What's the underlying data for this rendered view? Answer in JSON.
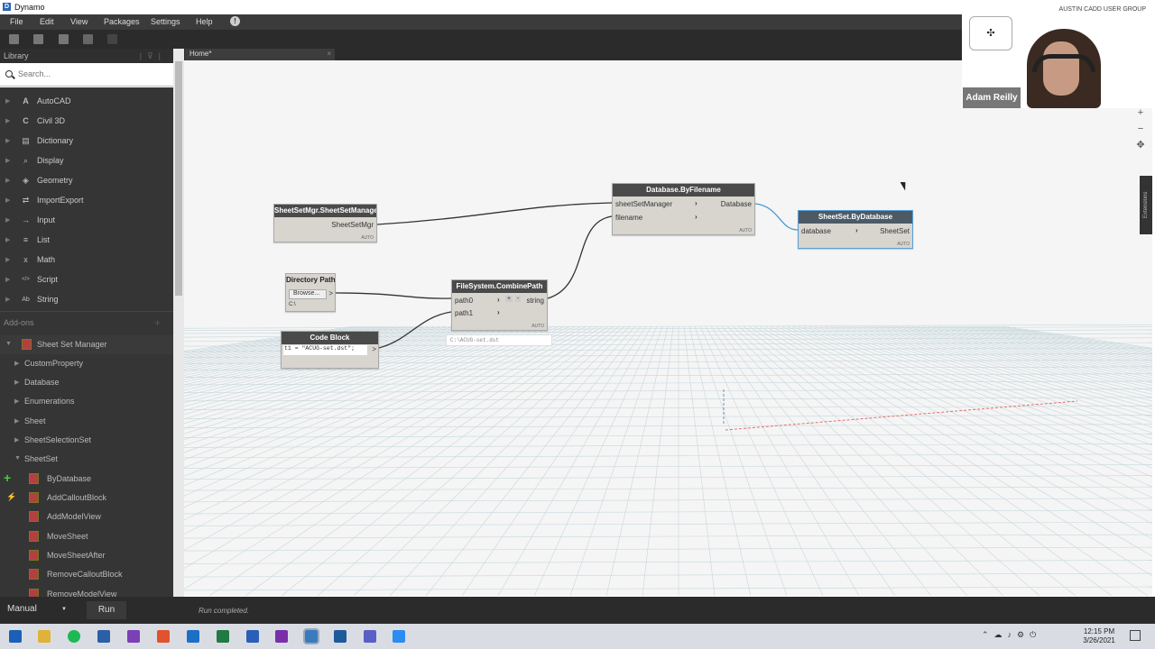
{
  "app": {
    "title": "Dynamo"
  },
  "menu": [
    "File",
    "Edit",
    "View",
    "Packages",
    "Settings",
    "Help"
  ],
  "library": {
    "title": "Library",
    "search_placeholder": "Search...",
    "categories": [
      {
        "label": "AutoCAD",
        "icon": "A"
      },
      {
        "label": "Civil 3D",
        "icon": "C"
      },
      {
        "label": "Dictionary",
        "icon": "▤"
      },
      {
        "label": "Display",
        "icon": "⌕"
      },
      {
        "label": "Geometry",
        "icon": "◈"
      },
      {
        "label": "ImportExport",
        "icon": "⇄"
      },
      {
        "label": "Input",
        "icon": "→"
      },
      {
        "label": "List",
        "icon": "≡"
      },
      {
        "label": "Math",
        "icon": "x"
      },
      {
        "label": "Script",
        "icon": "</>"
      },
      {
        "label": "String",
        "icon": "Ab"
      }
    ],
    "addons_label": "Add-ons",
    "package": "Sheet Set Manager",
    "subcats": [
      "CustomProperty",
      "Database",
      "Enumerations",
      "Sheet",
      "SheetSelectionSet",
      "SheetSet"
    ],
    "sheetset_nodes": [
      "ByDatabase",
      "AddCalloutBlock",
      "AddModelView",
      "MoveSheet",
      "MoveSheetAfter",
      "RemoveCalloutBlock",
      "RemoveModelView"
    ]
  },
  "tab": {
    "label": "Home*",
    "close": "×"
  },
  "nodes": {
    "ssmgr": {
      "title": "SheetSetMgr.SheetSetManager",
      "out": "SheetSetMgr",
      "lacing": "AUTO"
    },
    "dbfile": {
      "title": "Database.ByFilename",
      "in1": "sheetSetManager",
      "in2": "filename",
      "out": "Database",
      "lacing": "AUTO"
    },
    "ssdb": {
      "title": "SheetSet.ByDatabase",
      "in1": "database",
      "out": "SheetSet",
      "lacing": "AUTO"
    },
    "dirpath": {
      "title": "Directory Path",
      "button": "Browse...",
      "out": ">",
      "value": "C:\\"
    },
    "combine": {
      "title": "FileSystem.CombinePath",
      "in1": "path0",
      "in2": "path1",
      "plus": "+",
      "minus": "-",
      "out": "string",
      "lacing": "AUTO"
    },
    "code": {
      "title": "Code Block",
      "code": "t1 = \"ACUG-set.dst\";",
      "out": ">"
    },
    "preview": "C:\\ACUG-set.dst"
  },
  "status": {
    "run_mode": "Manual",
    "run_label": "Run",
    "message": "Run completed."
  },
  "zoom_controls": [
    "+",
    "−",
    "✥"
  ],
  "extensions_label": "Extensions",
  "camera": {
    "group": "AUSTIN CADD USER GROUP",
    "name": "Adam Reilly"
  },
  "clock": {
    "time": "12:15 PM",
    "date": "3/26/2021"
  }
}
